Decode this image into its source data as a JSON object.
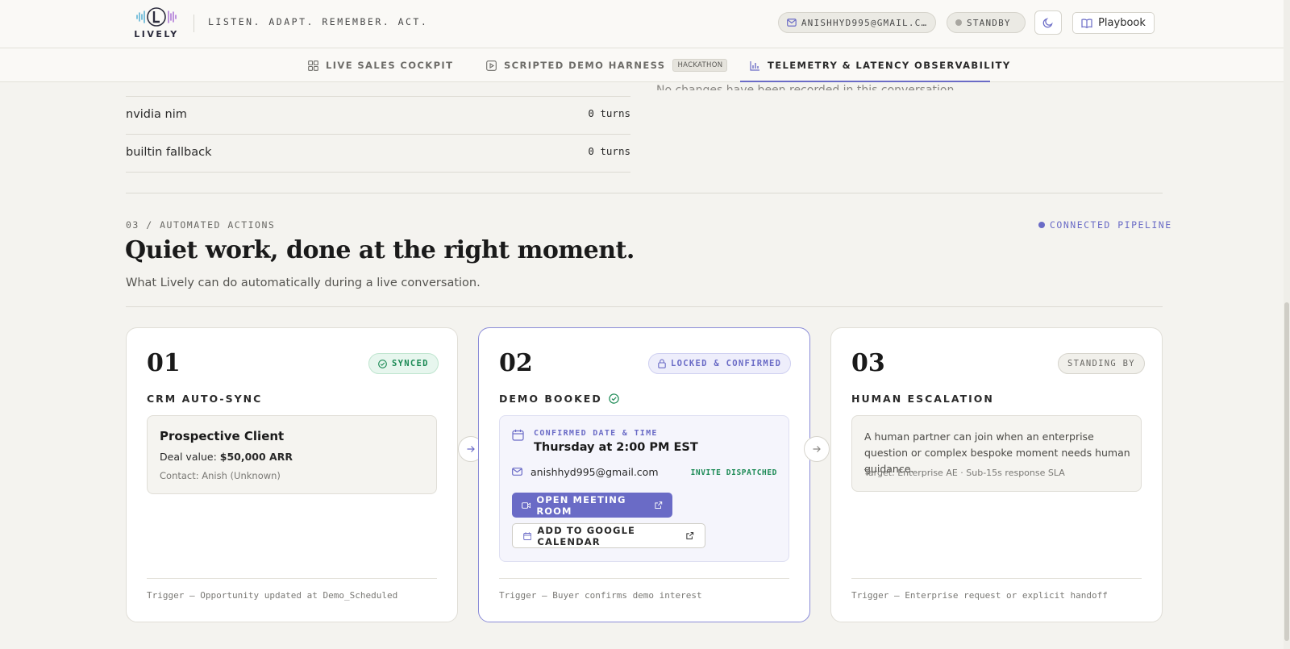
{
  "header": {
    "logo_word": "LIVELY",
    "tagline": "LISTEN. ADAPT. REMEMBER. ACT.",
    "email": "ANISHHYD995@GMAIL.CO…",
    "status": "STANDBY",
    "theme_icon": "moon-icon",
    "playbook_label": "Playbook"
  },
  "tabs": [
    {
      "label": "LIVE SALES COCKPIT",
      "icon": "grid-icon"
    },
    {
      "label": "SCRIPTED DEMO HARNESS",
      "icon": "play-icon",
      "badge": "HACKATHON"
    },
    {
      "label": "TELEMETRY & LATENCY OBSERVABILITY",
      "icon": "bar-chart-icon",
      "active": true
    }
  ],
  "upper": {
    "right_cut_text": "No changes have been recorded in this conversation.",
    "providers": [
      {
        "name": "nvidia nim",
        "turns": "0 turns"
      },
      {
        "name": "builtin fallback",
        "turns": "0 turns"
      }
    ]
  },
  "section": {
    "label": "03 / AUTOMATED ACTIONS",
    "connected": "CONNECTED PIPELINE",
    "title": "Quiet work, done at the right moment.",
    "subtitle": "What Lively can do automatically during a live conversation."
  },
  "cards": [
    {
      "num": "01",
      "badge": "SYNCED",
      "title": "CRM AUTO-SYNC",
      "client": "Prospective Client",
      "deal_label": "Deal value:",
      "deal_value": "$50,000 ARR",
      "contact": "Contact: Anish (Unknown)",
      "trigger": "Trigger — Opportunity updated at Demo_Scheduled"
    },
    {
      "num": "02",
      "badge": "LOCKED & CONFIRMED",
      "title": "DEMO BOOKED",
      "confirmed_label": "CONFIRMED DATE & TIME",
      "confirmed_value": "Thursday at 2:00 PM EST",
      "email": "anishhyd995@gmail.com",
      "invite": "INVITE DISPATCHED",
      "meet_button": "OPEN MEETING ROOM",
      "gcal_button": "ADD TO GOOGLE CALENDAR",
      "trigger": "Trigger — Buyer confirms demo interest"
    },
    {
      "num": "03",
      "badge": "STANDING BY",
      "title": "HUMAN ESCALATION",
      "text": "A human partner can join when an enterprise question or complex bespoke moment needs human guidance.",
      "target": "Target: Enterprise AE · Sub-15s response SLA",
      "trigger": "Trigger — Enterprise request or explicit handoff"
    }
  ],
  "colors": {
    "accent": "#6a6bc6",
    "success": "#1c8a55",
    "background": "#f4f3ef"
  }
}
